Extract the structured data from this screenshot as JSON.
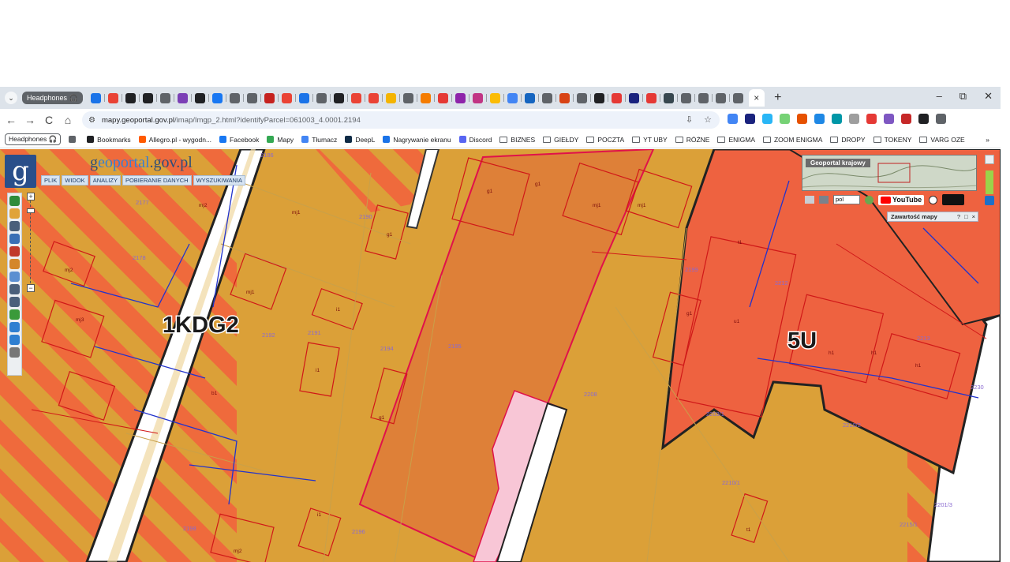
{
  "browser": {
    "tab_group_label": "Headphones 🎧",
    "active_tab_close": "×",
    "new_tab": "+",
    "window_controls": [
      "–",
      "⧉",
      "✕"
    ],
    "tab_icon_colors": [
      "#1a73e8",
      "#e94235",
      "#202124",
      "#202124",
      "#5f6368",
      "#7b3fb5",
      "#202124",
      "#1877f2",
      "#5f6368",
      "#5f6368",
      "#c5221f",
      "#ea4335",
      "#1a73e8",
      "#5f6368",
      "#202124",
      "#ea4335",
      "#ea4335",
      "#f4b400",
      "#5f6368",
      "#f57c00",
      "#e53935",
      "#8e24aa",
      "#c13584",
      "#fbbc04",
      "#4285f4",
      "#1565c0",
      "#5f6368",
      "#d84315",
      "#5f6368",
      "#202124",
      "#e53935",
      "#1a237e",
      "#e53935",
      "#37474f",
      "#5f6368",
      "#5f6368",
      "#5f6368",
      "#5f6368"
    ],
    "nav": {
      "back": "←",
      "forward": "→",
      "reload": "C",
      "home": "⌂"
    },
    "address": {
      "site_info": "⚙",
      "host": "mapy.geoportal.gov.pl",
      "path": "/imap/Imgp_2.html?identifyParcel=061003_4.0001.2194",
      "right_icons": [
        "⇩",
        "☆"
      ]
    },
    "extension_colors": [
      "#4285f4",
      "#1a237e",
      "#29b6f6",
      "#76d275",
      "#e65100",
      "#1e88e5",
      "#0097a7",
      "#9e9e9e",
      "#e53935",
      "#7e57c2",
      "#c62828",
      "#202124",
      "#5f6368"
    ],
    "bookmarks": [
      {
        "label": "Headphones 🎧",
        "kind": "group",
        "color": "#5f6368"
      },
      {
        "label": "",
        "kind": "apps",
        "color": "#5f6368"
      },
      {
        "label": "Bookmarks",
        "kind": "link",
        "color": "#202124"
      },
      {
        "label": "Allegro.pl - wygodn...",
        "kind": "link",
        "color": "#ff5a00"
      },
      {
        "label": "Facebook",
        "kind": "link",
        "color": "#1877f2"
      },
      {
        "label": "Mapy",
        "kind": "link",
        "color": "#34a853"
      },
      {
        "label": "Tłumacz",
        "kind": "link",
        "color": "#4285f4"
      },
      {
        "label": "DeepL",
        "kind": "link",
        "color": "#0f2b46"
      },
      {
        "label": "Nagrywanie ekranu",
        "kind": "link",
        "color": "#1a73e8"
      },
      {
        "label": "Discord",
        "kind": "link",
        "color": "#5865f2"
      },
      {
        "label": "BIZNES",
        "kind": "folder",
        "color": "#5f6368"
      },
      {
        "label": "GIEŁDY",
        "kind": "folder",
        "color": "#5f6368"
      },
      {
        "label": "POCZTA",
        "kind": "folder",
        "color": "#5f6368"
      },
      {
        "label": "YT UBY",
        "kind": "folder",
        "color": "#5f6368"
      },
      {
        "label": "RÓŻNE",
        "kind": "folder",
        "color": "#5f6368"
      },
      {
        "label": "ENIGMA",
        "kind": "folder",
        "color": "#5f6368"
      },
      {
        "label": "ZOOM ENIGMA",
        "kind": "folder",
        "color": "#5f6368"
      },
      {
        "label": "DROPY",
        "kind": "folder",
        "color": "#5f6368"
      },
      {
        "label": "TOKENY",
        "kind": "folder",
        "color": "#5f6368"
      },
      {
        "label": "VARG OZE",
        "kind": "folder",
        "color": "#5f6368"
      }
    ],
    "bookmarks_overflow": "»"
  },
  "geoportal": {
    "logo_letter": "g",
    "brand_main": "eoportal",
    "brand_prefix": "g",
    "brand_suffix": ".gov.pl",
    "menu": [
      "PLIK",
      "WIDOK",
      "ANALIZY",
      "POBIERANIE DANYCH",
      "WYSZUKIWANIA"
    ],
    "tool_colors": [
      "#2e8b3a",
      "#e0a33a",
      "#4a5f7a",
      "#3a6fb5",
      "#c0392b",
      "#d4862a",
      "#5b8fd1",
      "#4a5f7a",
      "#4a5f7a",
      "#3a9a3a",
      "#2f7fd1",
      "#2f7fd1",
      "#777777"
    ],
    "overview_title": "Geoportal krajowy",
    "language": "pol",
    "youtube_label": "YouTube",
    "contents_panel": "Zawartość mapy",
    "contents_controls": [
      "?",
      "□",
      "×"
    ]
  },
  "map": {
    "zone_labels": [
      "1KDG2",
      "5U"
    ],
    "parcel_labels": [
      "2190",
      "2191",
      "2192",
      "2194",
      "2195",
      "2196",
      "2198",
      "2199",
      "2208",
      "2210/2",
      "2210/1",
      "2212",
      "2213",
      "2215/1",
      "2203/1",
      "2201/3",
      "2230",
      "2177",
      "2178",
      "2186"
    ],
    "building_labels": [
      "mj1",
      "mj2",
      "mj1",
      "mj1",
      "mj1",
      "mj2",
      "g1",
      "g1",
      "g1",
      "g1",
      "g1",
      "i1",
      "i1",
      "i1",
      "b1",
      "t1",
      "t1",
      "h1",
      "h1",
      "h1",
      "u1",
      "mj2",
      "mj3"
    ],
    "colors": {
      "base": "#dba038",
      "stripe": "#ef6a3c",
      "parcel_2194": "#de8038",
      "service_zone": "#ee6240",
      "road": "#ffffff",
      "pink_zone": "#f8c6d6",
      "boundary_red": "#e0114a",
      "utility_blue": "#2233cc",
      "thin_red": "#d01818"
    }
  }
}
